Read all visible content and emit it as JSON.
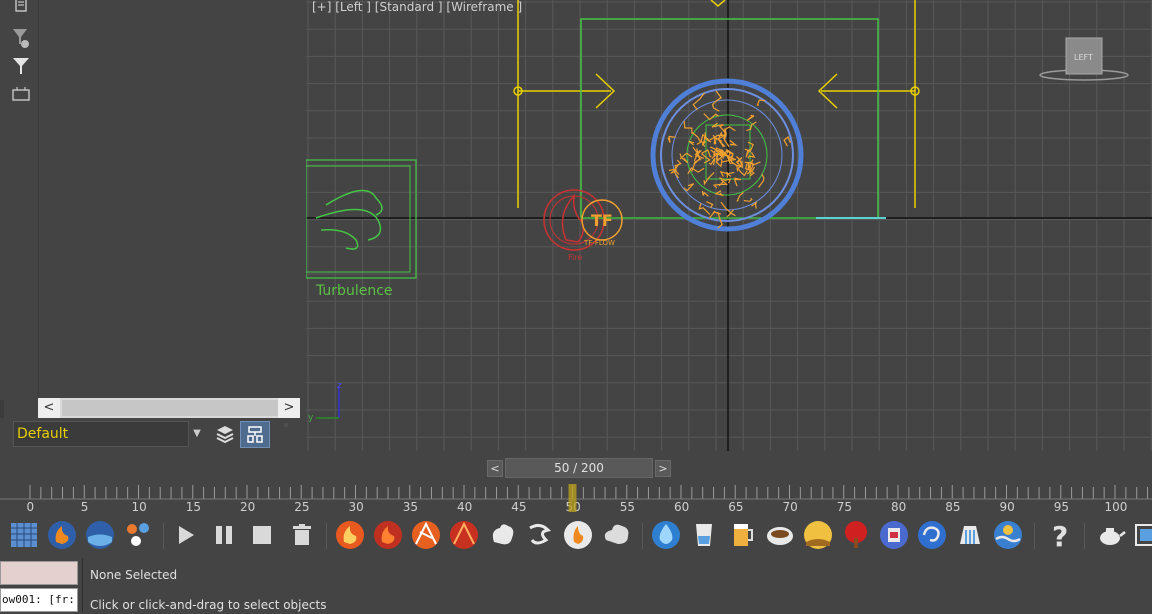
{
  "viewport": {
    "label": "[+] [Left ] [Standard ] [Wireframe ]",
    "turbulence_label": "Turbulence",
    "fire_label": "Fire",
    "tflow_label": "TF-FLOW",
    "viewcube_label": "LEFT",
    "axis_z": "z",
    "axis_y": "y"
  },
  "layer": {
    "current": "Default"
  },
  "time": {
    "prev": "<",
    "next": ">",
    "display": "50 / 200",
    "current_frame": 50
  },
  "ruler": {
    "labels": [
      "0",
      "5",
      "10",
      "15",
      "20",
      "25",
      "30",
      "35",
      "40",
      "45",
      "50",
      "55",
      "60",
      "65",
      "70",
      "75",
      "80",
      "85",
      "90",
      "95",
      "100"
    ],
    "marker_frame": 50
  },
  "hscroll": {
    "left": "<",
    "right": ">"
  },
  "status": {
    "selection": "None Selected",
    "prompt": "Click or click-and-drag to select objects",
    "script_text": "ow001: [fr:"
  },
  "icons": {
    "left_toolbar": [
      "document-icon",
      "filter-options-icon",
      "filter-icon",
      "hierarchy-icon"
    ],
    "tools": [
      "grid-icon",
      "fire-icon",
      "water-icon",
      "particles-icon",
      "play-icon",
      "pause-icon",
      "stop-icon",
      "trash-icon"
    ]
  },
  "colors": {
    "panel": "#444444",
    "grid": "#585858",
    "grid_axis": "#111111",
    "yellow": "#e8d000",
    "green": "#45c545",
    "blue": "#4f7fd6",
    "orange": "#f0a030",
    "accent_blue": "#4f6c8e"
  }
}
